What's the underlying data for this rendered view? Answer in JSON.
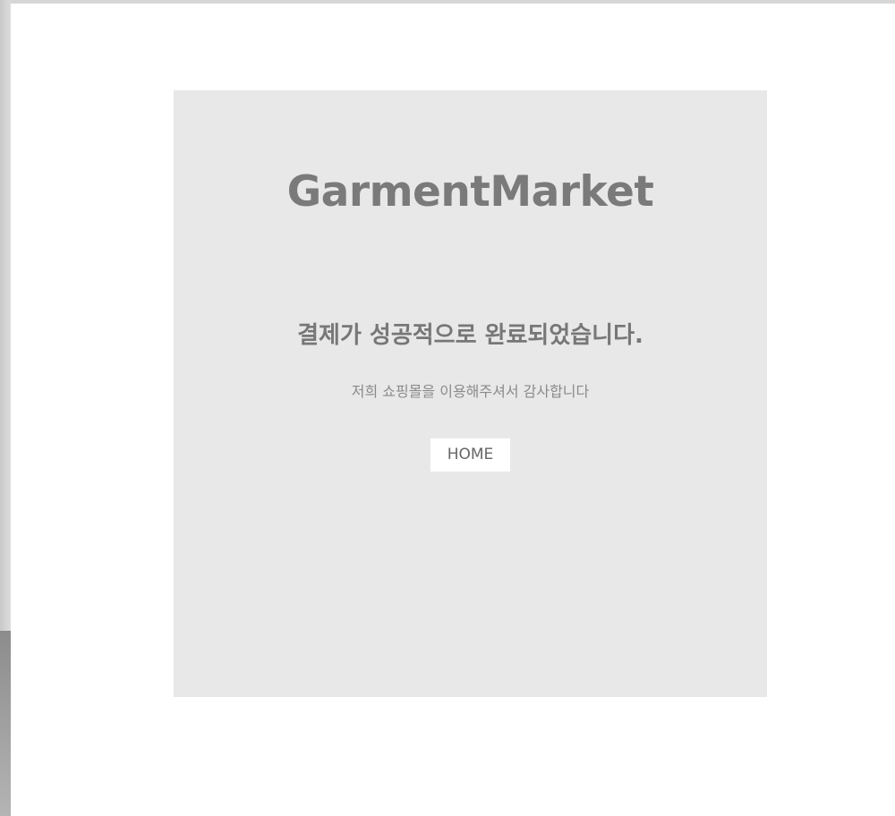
{
  "brand": {
    "name": "GarmentMarket"
  },
  "message": {
    "title": "결제가 성공적으로 완료되었습니다.",
    "subtitle": "저희 쇼핑몰을 이용해주셔서 감사합니다"
  },
  "actions": {
    "home_label": "HOME"
  },
  "colors": {
    "card_background": "#e8e8e8",
    "page_background": "#ffffff",
    "text_primary": "#7a7a7a"
  }
}
